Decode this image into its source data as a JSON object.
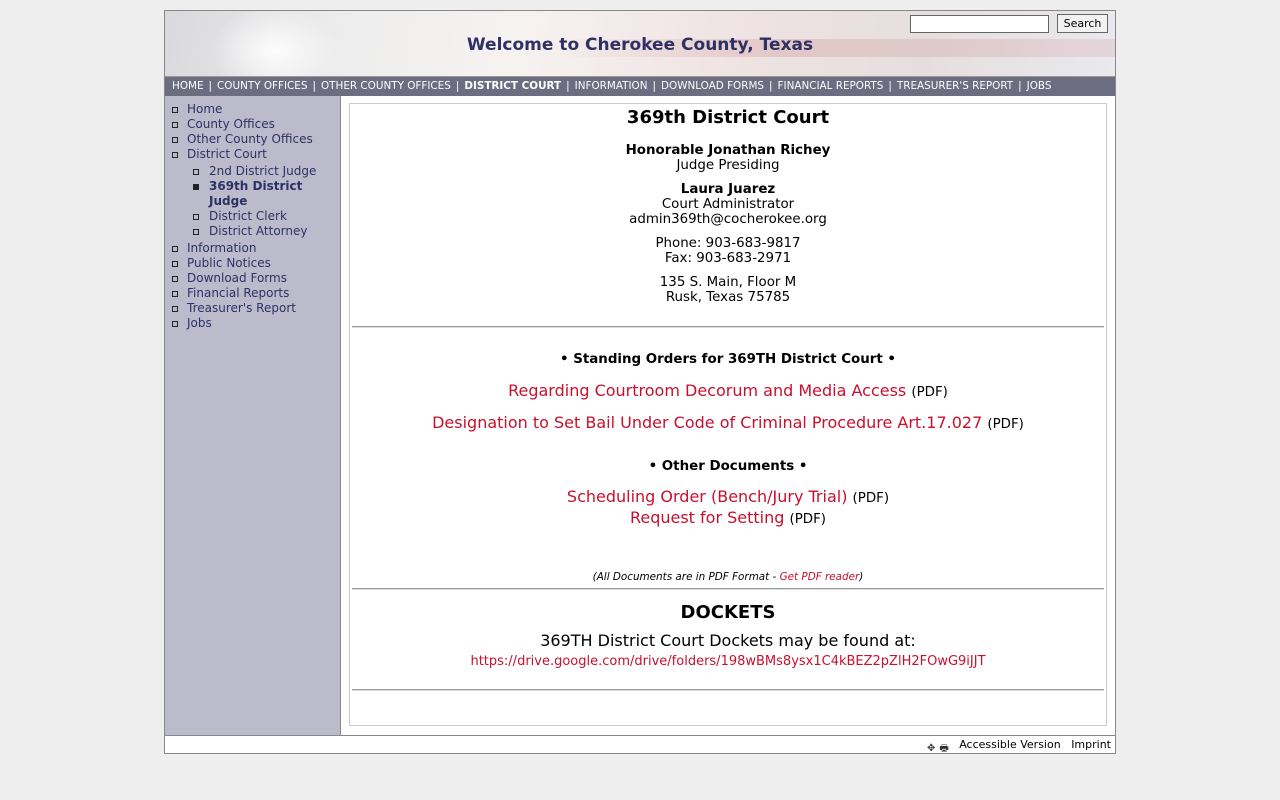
{
  "header": {
    "title": "Welcome to Cherokee County, Texas",
    "search_placeholder": "",
    "search_button": "Search"
  },
  "topnav": [
    {
      "label": "HOME",
      "active": false
    },
    {
      "label": "COUNTY OFFICES",
      "active": false
    },
    {
      "label": "OTHER COUNTY OFFICES",
      "active": false
    },
    {
      "label": "DISTRICT COURT",
      "active": true
    },
    {
      "label": "INFORMATION",
      "active": false
    },
    {
      "label": "DOWNLOAD FORMS",
      "active": false
    },
    {
      "label": "FINANCIAL REPORTS",
      "active": false
    },
    {
      "label": "TREASURER'S REPORT",
      "active": false
    },
    {
      "label": "JOBS",
      "active": false
    }
  ],
  "topnav_separator": "|",
  "sidebar": {
    "items": [
      {
        "label": "Home"
      },
      {
        "label": "County Offices"
      },
      {
        "label": "Other County Offices"
      },
      {
        "label": "District Court"
      },
      {
        "label": "Information"
      },
      {
        "label": "Public Notices"
      },
      {
        "label": "Download Forms"
      },
      {
        "label": "Financial Reports"
      },
      {
        "label": "Treasurer's Report"
      },
      {
        "label": "Jobs"
      }
    ],
    "district_court_sub": [
      {
        "label": "2nd District Judge",
        "active": false
      },
      {
        "label": "369th District Judge",
        "active": true
      },
      {
        "label": "District Clerk",
        "active": false
      },
      {
        "label": "District Attorney",
        "active": false
      }
    ]
  },
  "main": {
    "heading": "369th District Court",
    "judge_name": "Honorable Jonathan Richey",
    "judge_title": "Judge Presiding",
    "admin_name": "Laura Juarez",
    "admin_title": "Court Administrator",
    "admin_email": "admin369th@cocherokee.org",
    "phone": "Phone: 903-683-9817",
    "fax": "Fax: 903-683-2971",
    "address_line1": "135 S. Main, Floor M",
    "address_line2": "Rusk, Texas 75785",
    "standing_orders_title": "• Standing Orders for 369TH District Court •",
    "standing_orders": [
      {
        "label": "Regarding Courtroom Decorum and Media Access",
        "suffix": "(PDF)"
      },
      {
        "label": "Designation to Set Bail Under Code of Criminal Procedure Art.17.027",
        "suffix": "(PDF)"
      }
    ],
    "other_docs_title": "• Other Documents •",
    "other_docs": [
      {
        "label": "Scheduling Order (Bench/Jury Trial)",
        "suffix": "(PDF)"
      },
      {
        "label": "Request for Setting",
        "suffix": "(PDF)"
      }
    ],
    "pdf_note_prefix": "(All Documents are in PDF Format - ",
    "pdf_note_link": "Get PDF reader",
    "pdf_note_suffix": ")",
    "dockets_title": "DOCKETS",
    "dockets_text": "369TH District Court Dockets may be found at:",
    "dockets_link": "https://drive.google.com/drive/folders/198wBMs8ysx1C4kBEZ2pZlH2FOwG9iJJT"
  },
  "footer": {
    "accessible": "Accessible Version",
    "imprint": "Imprint"
  },
  "colors": {
    "nav_bg": "#6c6d80",
    "sidebar_bg": "#bbbbcc",
    "link_red": "#c8102e",
    "title_blue": "#2e3163"
  }
}
